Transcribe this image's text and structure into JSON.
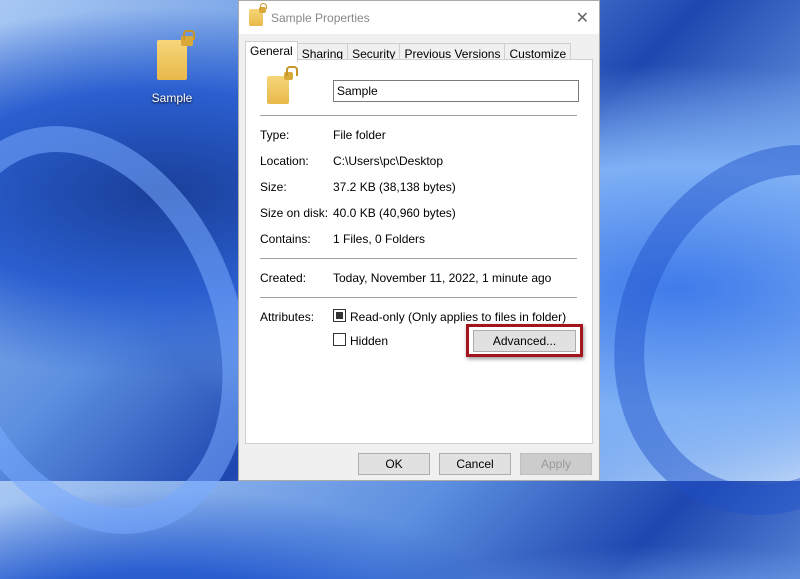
{
  "desktop": {
    "icon_label": "Sample"
  },
  "dialog": {
    "title": "Sample Properties",
    "tabs": [
      "General",
      "Sharing",
      "Security",
      "Previous Versions",
      "Customize"
    ],
    "name_value": "Sample",
    "info": [
      {
        "label": "Type:",
        "value": "File folder"
      },
      {
        "label": "Location:",
        "value": "C:\\Users\\pc\\Desktop"
      },
      {
        "label": "Size:",
        "value": "37.2 KB (38,138 bytes)"
      },
      {
        "label": "Size on disk:",
        "value": "40.0 KB (40,960 bytes)"
      },
      {
        "label": "Contains:",
        "value": "1 Files, 0 Folders"
      }
    ],
    "created": {
      "label": "Created:",
      "value": "Today, November 11, 2022, 1 minute ago"
    },
    "attributes": {
      "label": "Attributes:",
      "readonly": "Read-only (Only applies to files in folder)",
      "hidden": "Hidden",
      "advanced": "Advanced..."
    },
    "buttons": {
      "ok": "OK",
      "cancel": "Cancel",
      "apply": "Apply"
    }
  },
  "colors": {
    "highlight": "#a3141c"
  }
}
